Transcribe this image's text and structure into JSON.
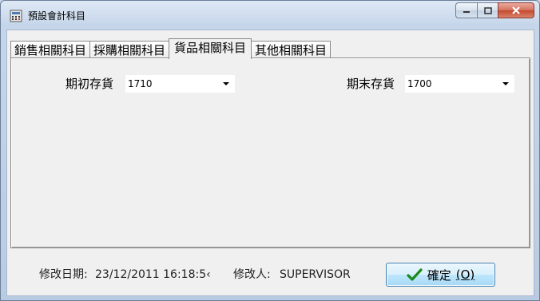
{
  "window": {
    "title": "預設會計科目",
    "icon": "calculator-icon"
  },
  "tabs": [
    {
      "label": "銷售相關科目",
      "active": false
    },
    {
      "label": "採購相關科目",
      "active": false
    },
    {
      "label": "貨品相關科目",
      "active": true
    },
    {
      "label": "其他相關科目",
      "active": false
    }
  ],
  "fields": {
    "opening_inventory": {
      "label": "期初存貨",
      "value": "1710"
    },
    "closing_inventory": {
      "label": "期末存貨",
      "value": "1700"
    }
  },
  "status": {
    "modified_date_label": "修改日期:",
    "modified_date_value": "23/12/2011 16:18:5‹",
    "modified_by_label": "修改人:",
    "modified_by_value": "SUPERVISOR"
  },
  "ok_button": {
    "label": "確定",
    "shortcut": "(O)",
    "icon": "checkmark-icon",
    "icon_color": "#1a8a1a"
  }
}
